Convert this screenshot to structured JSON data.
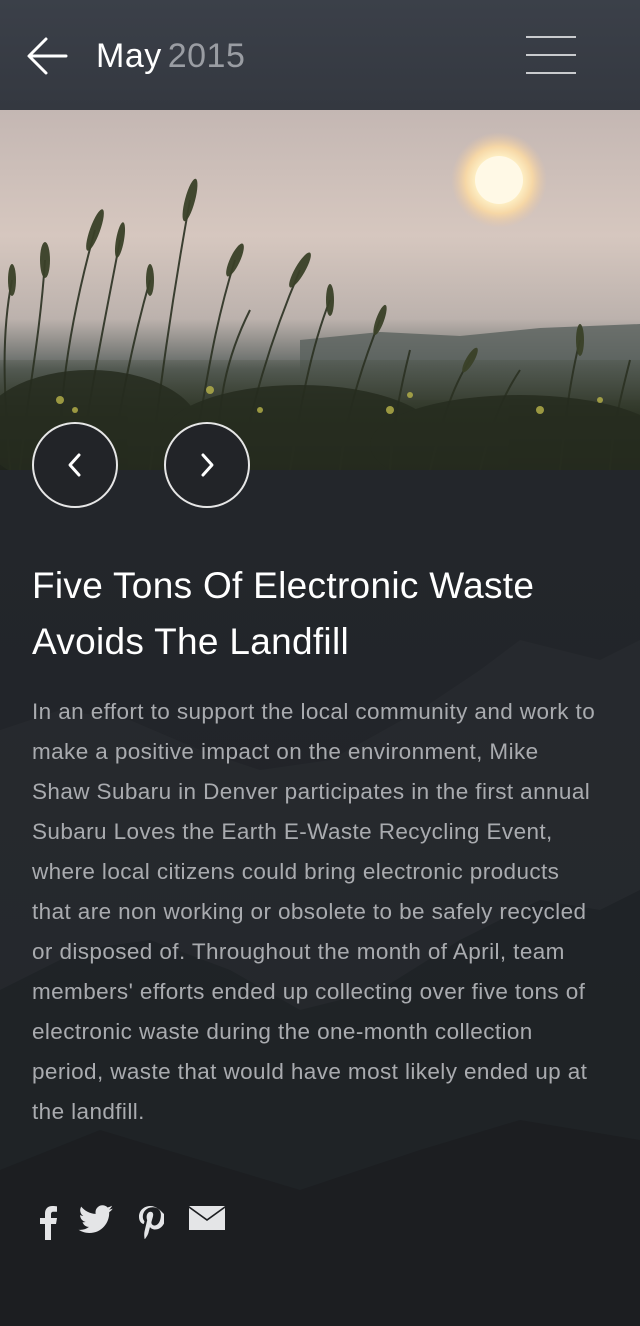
{
  "header": {
    "month": "May",
    "year": "2015",
    "back_icon": "arrow-left-icon",
    "menu_icon": "hamburger-menu-icon"
  },
  "hero": {
    "image_subject": "grass-at-sunset-photo"
  },
  "carousel": {
    "prev_icon": "chevron-left-icon",
    "next_icon": "chevron-right-icon"
  },
  "article": {
    "title": "Five Tons Of Electronic Waste Avoids The Landfill",
    "body": "In an effort to support the local community and work to make a positive impact on the environment, Mike Shaw Subaru in Denver participates in the first annual Subaru Loves the Earth E-Waste Recycling Event, where local citizens could bring electronic products that are non working or obsolete to be safely recycled or disposed of. Throughout the month of April, team members' efforts ended up collecting over five tons of electronic waste during the one-month collection period, waste that would have most likely ended up at the landfill."
  },
  "share": {
    "icons": [
      "facebook-icon",
      "twitter-icon",
      "pinterest-icon",
      "email-icon"
    ]
  },
  "colors": {
    "header_bg": "#393d45",
    "page_bg": "#232529",
    "title_text": "#ffffff",
    "body_text": "#a9abaf",
    "year_text": "#9a9da3"
  }
}
